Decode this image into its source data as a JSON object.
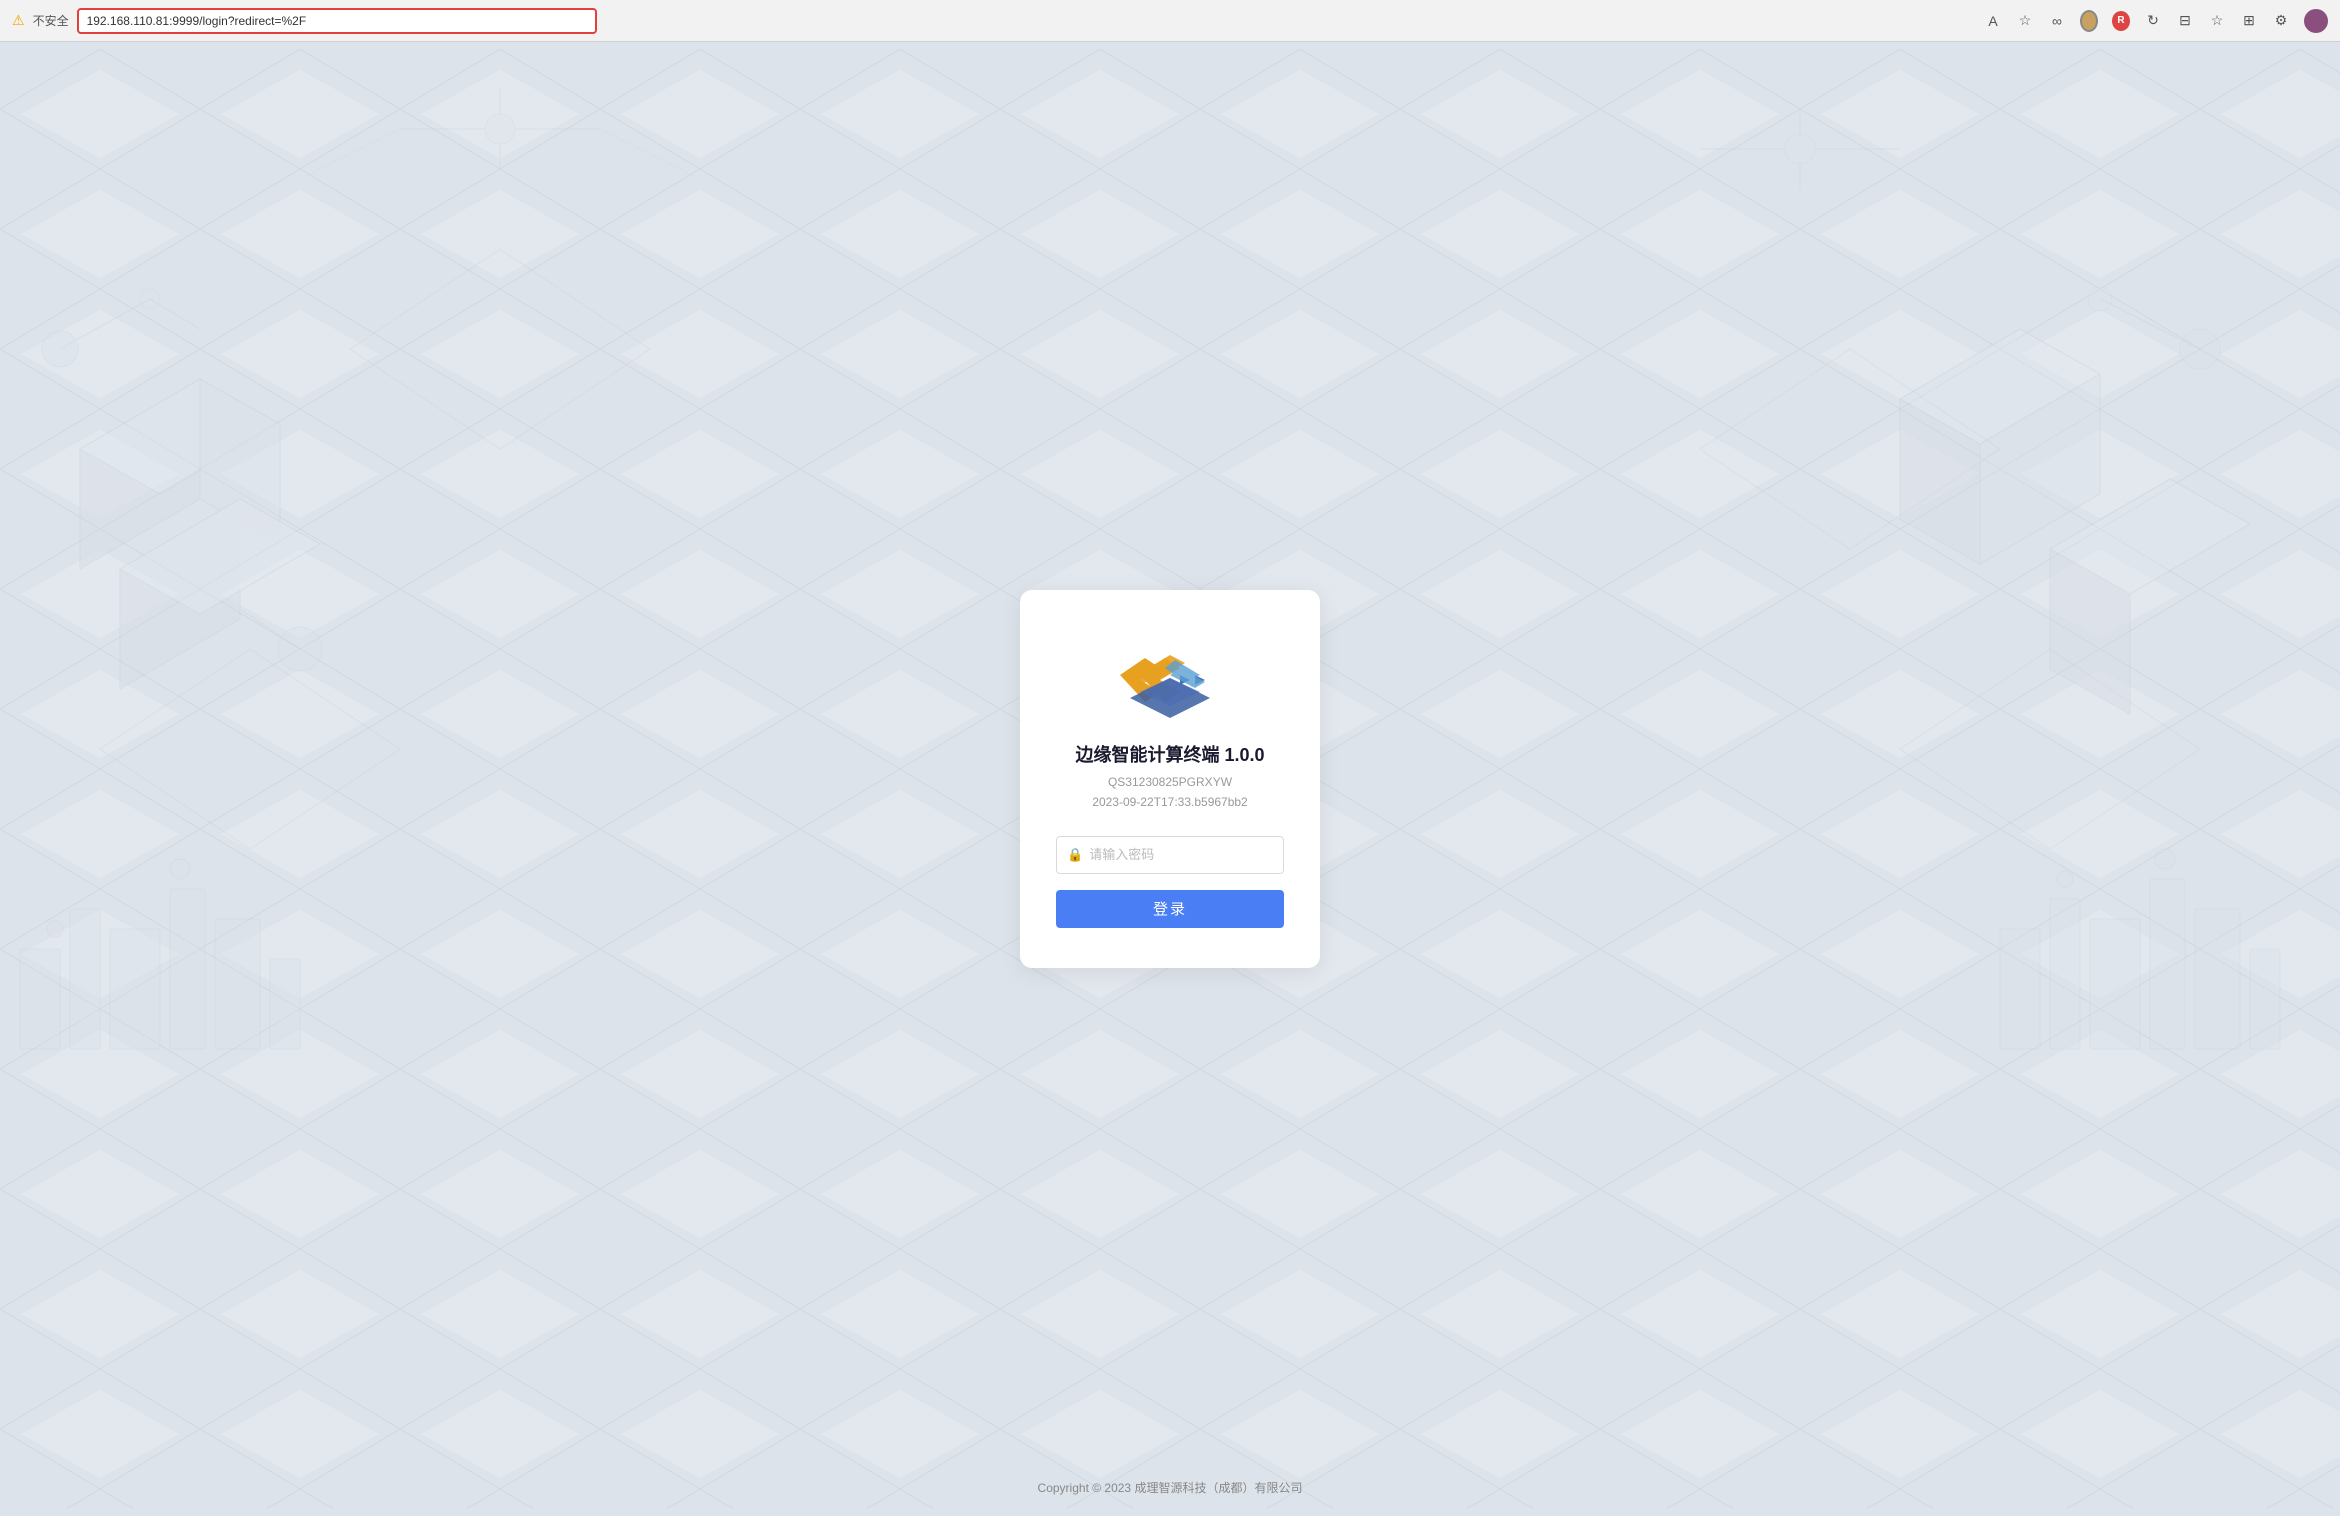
{
  "browser": {
    "warning_label": "不安全",
    "address": "192.168.110.81:9999/login?redirect=%2F"
  },
  "app": {
    "title": "边缘智能计算终端 1.0.0",
    "build_code": "QS31230825PGRXYW",
    "build_date": "2023-09-22T17:33.b5967bb2",
    "password_placeholder": "请输入密码",
    "login_button": "登录"
  },
  "footer": {
    "copyright": "Copyright © 2023 成理智源科技（成都）有限公司"
  },
  "colors": {
    "accent_blue": "#4a7ef5",
    "logo_gold": "#e8a020",
    "logo_blue": "#3a6acc",
    "bg": "#dde3ea"
  }
}
